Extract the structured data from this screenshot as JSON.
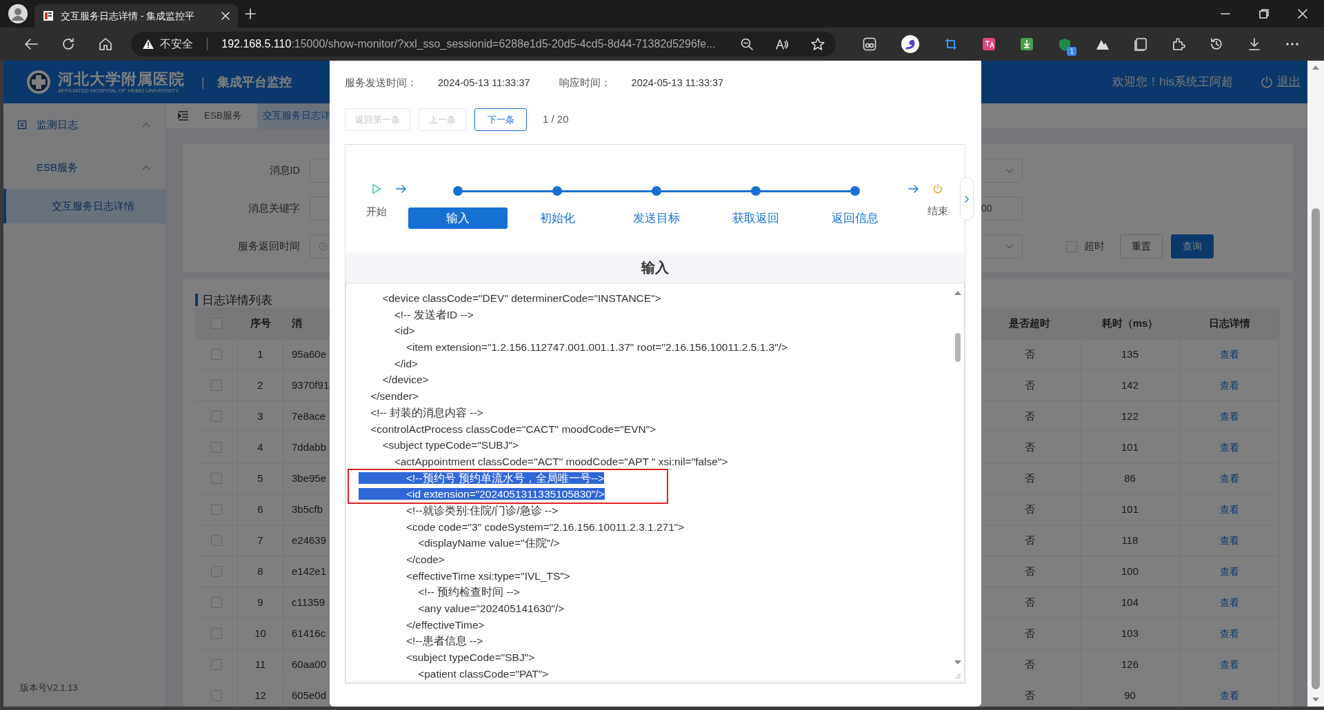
{
  "browser": {
    "tab_title": "交互服务日志详情 - 集成监控平",
    "security": "不安全",
    "url_host": "192.168.5.110",
    "url_rest": ":15000/show-monitor/?xxl_sso_sessionid=6288e1d5-20d5-4cd5-8d44-71382d5296fe...",
    "extension_badge": "1"
  },
  "header": {
    "hospital_name": "河北大学附属医院",
    "hospital_name_en": "AFFILIATED HOSPITAL OF HEBEI UNIVERSITY",
    "separator": "|",
    "system_title": "集成平台监控",
    "welcome": "欢迎您！his系统王阿超",
    "logout": "退出"
  },
  "sidebar": {
    "items": [
      {
        "label": "监测日志",
        "expanded": true,
        "children": [
          {
            "label": "ESB服务",
            "expanded": true,
            "children": [
              {
                "label": "交互服务日志详情",
                "selected": true
              }
            ]
          }
        ]
      }
    ],
    "version": "版本号V2.1.13"
  },
  "tabs": [
    {
      "label": "ESB服务",
      "selected": false
    },
    {
      "label": "交互服务日志详",
      "selected": true
    }
  ],
  "search": {
    "fields": [
      {
        "label": "消息ID",
        "kind": "select"
      },
      {
        "label": "消息关键字",
        "kind": "input"
      },
      {
        "label": "服务返回时间",
        "kind": "datetime"
      }
    ],
    "right_fields": [
      {
        "kind": "select"
      },
      {
        "kind": "input",
        "value": "00"
      },
      {
        "kind": "select"
      }
    ],
    "timeout": {
      "label": "超时",
      "checked": false
    },
    "buttons": [
      {
        "label": "重置",
        "kind": "default"
      },
      {
        "label": "查询",
        "kind": "primary"
      }
    ]
  },
  "table": {
    "title": "日志详情列表",
    "header_checked": false,
    "columns_left": [
      "序号",
      "消"
    ],
    "columns_right": [
      "是否超时",
      "耗时（ms）",
      "日志详情"
    ],
    "rows": [
      {
        "checked": false,
        "index": "1",
        "message": "95a60e",
        "timeout": "否",
        "duration": "135",
        "action": "查看"
      },
      {
        "checked": false,
        "index": "2",
        "message": "9370f91",
        "timeout": "否",
        "duration": "142",
        "action": "查看"
      },
      {
        "checked": false,
        "index": "3",
        "message": "7e8ace",
        "timeout": "否",
        "duration": "122",
        "action": "查看"
      },
      {
        "checked": false,
        "index": "4",
        "message": "7ddabb",
        "timeout": "否",
        "duration": "101",
        "action": "查看"
      },
      {
        "checked": false,
        "index": "5",
        "message": "3be95e",
        "timeout": "否",
        "duration": "86",
        "action": "查看"
      },
      {
        "checked": false,
        "index": "6",
        "message": "3b5cfb",
        "timeout": "否",
        "duration": "101",
        "action": "查看"
      },
      {
        "checked": false,
        "index": "7",
        "message": "e24639",
        "timeout": "否",
        "duration": "118",
        "action": "查看"
      },
      {
        "checked": false,
        "index": "8",
        "message": "e142e1",
        "timeout": "否",
        "duration": "100",
        "action": "查看"
      },
      {
        "checked": false,
        "index": "9",
        "message": "c11359",
        "timeout": "否",
        "duration": "104",
        "action": "查看"
      },
      {
        "checked": false,
        "index": "10",
        "message": "61416c",
        "timeout": "否",
        "duration": "103",
        "action": "查看"
      },
      {
        "checked": false,
        "index": "11",
        "message": "60aa00",
        "timeout": "否",
        "duration": "126",
        "action": "查看"
      },
      {
        "checked": false,
        "index": "12",
        "message": "605e0d",
        "timeout": "否",
        "duration": "90",
        "action": "查看"
      }
    ]
  },
  "modal": {
    "send_time_label": "服务发送时间：",
    "send_time": "2024-05-13 11:33:37",
    "response_time_label": "响应时间：",
    "response_time": "2024-05-13 11:33:37",
    "nav_buttons": [
      {
        "label": "返回第一条",
        "disabled": true
      },
      {
        "label": "上一条",
        "disabled": true
      },
      {
        "label": "下一条",
        "disabled": false
      }
    ],
    "pager": "1 / 20",
    "flow": {
      "start": "开始",
      "end": "结束",
      "steps": [
        {
          "label": "输入",
          "selected": true
        },
        {
          "label": "初始化",
          "selected": false
        },
        {
          "label": "发送目标",
          "selected": false
        },
        {
          "label": "获取返回",
          "selected": false
        },
        {
          "label": "返回信息",
          "selected": false
        }
      ]
    },
    "panel": {
      "title": "输入",
      "lines": [
        {
          "text": "        <device classCode=\"DEV\" determinerCode=\"INSTANCE\">",
          "selected": false,
          "boxed": false
        },
        {
          "text": "            <!-- 发送者ID -->",
          "selected": false,
          "boxed": false
        },
        {
          "text": "            <id>",
          "selected": false,
          "boxed": false
        },
        {
          "text": "                <item extension=\"1.2.156.112747.001.001.1.37\" root=\"2.16.156.10011.2.5.1.3\"/>",
          "selected": false,
          "boxed": false
        },
        {
          "text": "            </id>",
          "selected": false,
          "boxed": false
        },
        {
          "text": "        </device>",
          "selected": false,
          "boxed": false
        },
        {
          "text": "    </sender>",
          "selected": false,
          "boxed": false
        },
        {
          "text": "    <!-- 封装的消息内容 -->",
          "selected": false,
          "boxed": false
        },
        {
          "text": "    <controlActProcess classCode=\"CACT\" moodCode=\"EVN\">",
          "selected": false,
          "boxed": false
        },
        {
          "text": "        <subject typeCode=\"SUBJ\">",
          "selected": false,
          "boxed": false
        },
        {
          "text": "            <actAppointment classCode=\"ACT\" moodCode=\"APT \" xsi:nil=\"false\">",
          "selected": false,
          "boxed": false
        },
        {
          "text": "                <!--预约号 预约单流水号，全局唯一号-->",
          "selected": true,
          "boxed": true
        },
        {
          "text": "                <id extension=\"2024051311335105830\"/>",
          "selected": true,
          "boxed": true
        },
        {
          "text": "                <!--就诊类别:住院/门诊/急诊 -->",
          "selected": false,
          "boxed": false
        },
        {
          "text": "                <code code=\"3\" codeSystem=\"2.16.156.10011.2.3.1.271\">",
          "selected": false,
          "boxed": false
        },
        {
          "text": "                    <displayName value=\"住院\"/>",
          "selected": false,
          "boxed": false
        },
        {
          "text": "                </code>",
          "selected": false,
          "boxed": false
        },
        {
          "text": "                <effectiveTime xsi:type=\"IVL_TS\">",
          "selected": false,
          "boxed": false
        },
        {
          "text": "                    <!-- 预约检查时间 -->",
          "selected": false,
          "boxed": false
        },
        {
          "text": "                    <any value=\"202405141630\"/>",
          "selected": false,
          "boxed": false
        },
        {
          "text": "                </effectiveTime>",
          "selected": false,
          "boxed": false
        },
        {
          "text": "                <!--患者信息 -->",
          "selected": false,
          "boxed": false
        },
        {
          "text": "                <subject typeCode=\"SBJ\">",
          "selected": false,
          "boxed": false
        },
        {
          "text": "                    <patient classCode=\"PAT\">",
          "selected": false,
          "boxed": false
        }
      ]
    }
  }
}
